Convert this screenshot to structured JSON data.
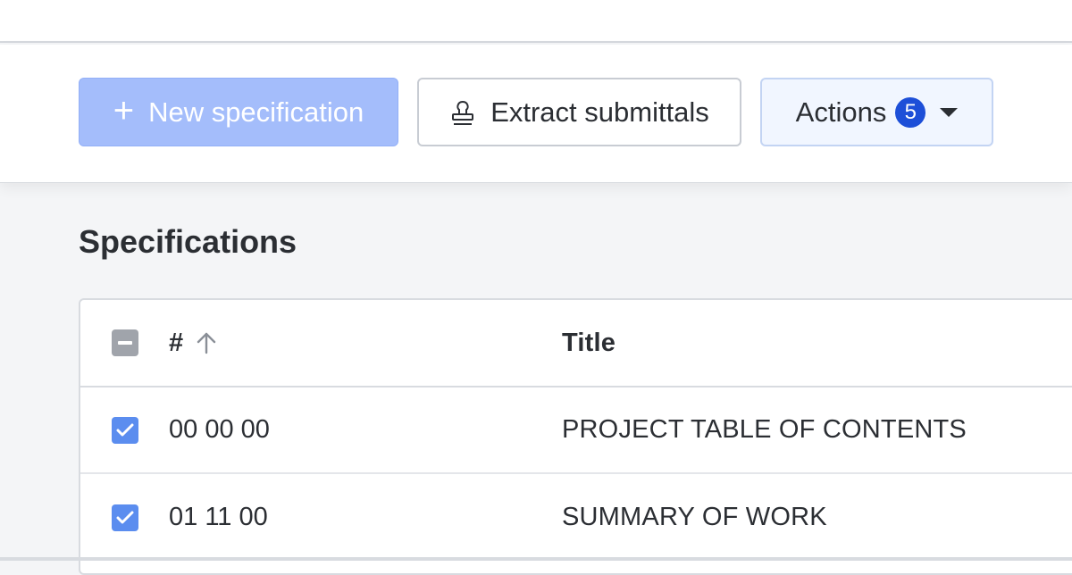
{
  "toolbar": {
    "new_label": "New specification",
    "extract_label": "Extract submittals",
    "actions_label": "Actions",
    "actions_count": "5"
  },
  "page_title": "Specifications",
  "table": {
    "headers": {
      "number": "#",
      "title": "Title"
    },
    "rows": [
      {
        "number": "00 00 00",
        "title": "PROJECT TABLE OF CONTENTS",
        "checked": true
      },
      {
        "number": "01 11 00",
        "title": "SUMMARY OF WORK",
        "checked": true
      }
    ]
  },
  "icons": {
    "new": "plus-icon",
    "extract": "stamp-icon",
    "actions": "chevron-down-icon",
    "sort": "arrow-up-icon",
    "select_all": "checkbox-indeterminate-icon",
    "row_checkbox": "checkbox-checked-icon"
  },
  "colors": {
    "primary_disabled": "#a4bdfb",
    "badge": "#1d4fd8",
    "checkbox": "#5b8def"
  }
}
